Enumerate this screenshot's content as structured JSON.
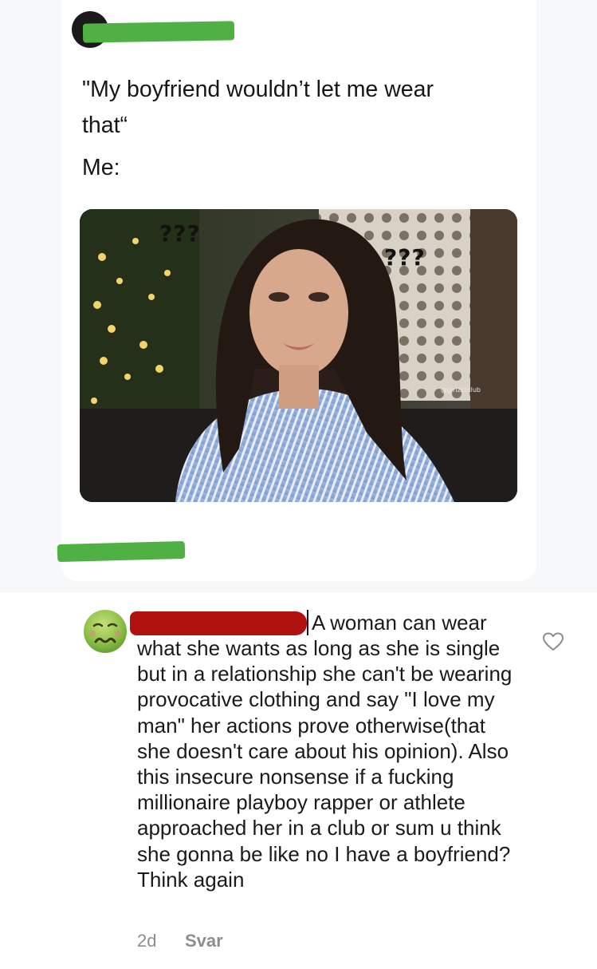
{
  "tweet": {
    "line1": "\"My boyfriend wouldn’t let me wear",
    "line2": "that“",
    "line3": "Me:",
    "image": {
      "overlay_left": "???",
      "overlay_right": "???",
      "watermark": "@girlzzzclub"
    }
  },
  "comment": {
    "avatar_icon": "nauseated-face-emoji",
    "first_line": "A woman can wear",
    "body": "what she wants as long as she is single but in a relationship she can't be wearing provocative clothing and say \"I love my man\" her actions prove otherwise(that she doesn't care about his opinion). Also this insecure nonsense if a fucking millionaire playboy rapper or athlete approached her in a club or sum u think she gonna be like no I have a boyfriend? Think again",
    "time": "2d",
    "reply_label": "Svar",
    "like_icon": "heart-outline-icon"
  },
  "colors": {
    "redaction_green": "#4fb043",
    "redaction_red": "#b0120f",
    "card_bg": "#ffffff",
    "page_bg": "#f7f8f9"
  }
}
